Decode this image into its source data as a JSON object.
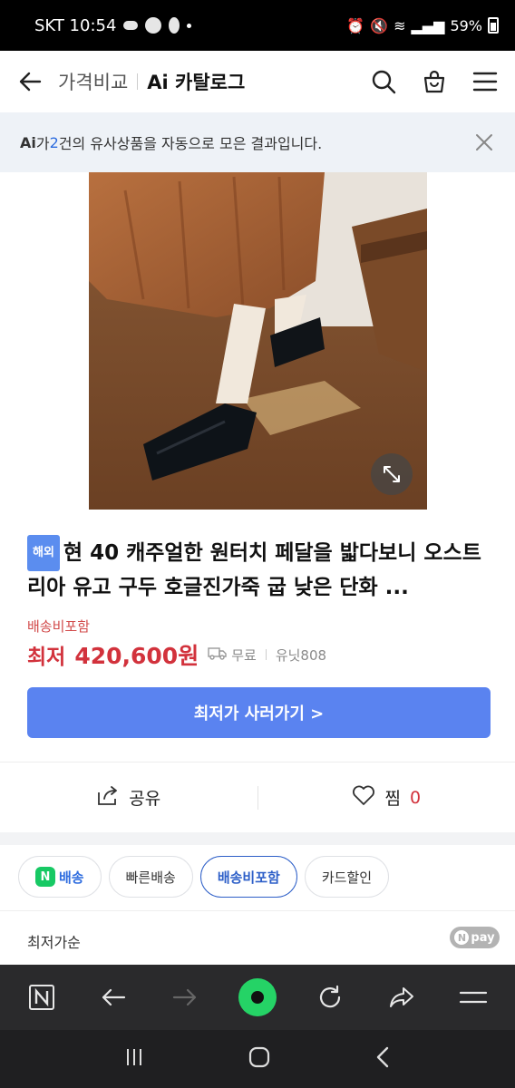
{
  "status": {
    "carrier_time": "SKT 10:54",
    "battery": "59%"
  },
  "header": {
    "crumb": "가격비교",
    "title": "Ai 카탈로그"
  },
  "banner": {
    "prefix": "Ai",
    "text1": "가 ",
    "count": "2",
    "text2": "건의 유사상품을 자동으로 모은 결과입니다."
  },
  "product": {
    "badge": "해외",
    "name": "현 40 캐주얼한 원터치 페달을 밟다보니 오스트리아 유고 구두 호글진가죽 굽 낮은 단화 ...",
    "shipping_included": "배송비포함",
    "price_label": "최저",
    "price": "420,600원",
    "delivery": "무료",
    "seller": "유닛808",
    "cta": "최저가 사러가기 >"
  },
  "actions": {
    "share": "공유",
    "like": "찜",
    "like_count": "0"
  },
  "chips": {
    "npay_letter": "N",
    "npay_label": "배송",
    "fast": "빠른배송",
    "shipping_included": "배송비포함",
    "card": "카드할인"
  },
  "sort": {
    "label": "최저가순",
    "npay_n": "N",
    "npay": "pay"
  },
  "colors": {
    "accent_blue": "#5a83f0",
    "price_red": "#d2323c",
    "npay_green": "#17c964"
  }
}
